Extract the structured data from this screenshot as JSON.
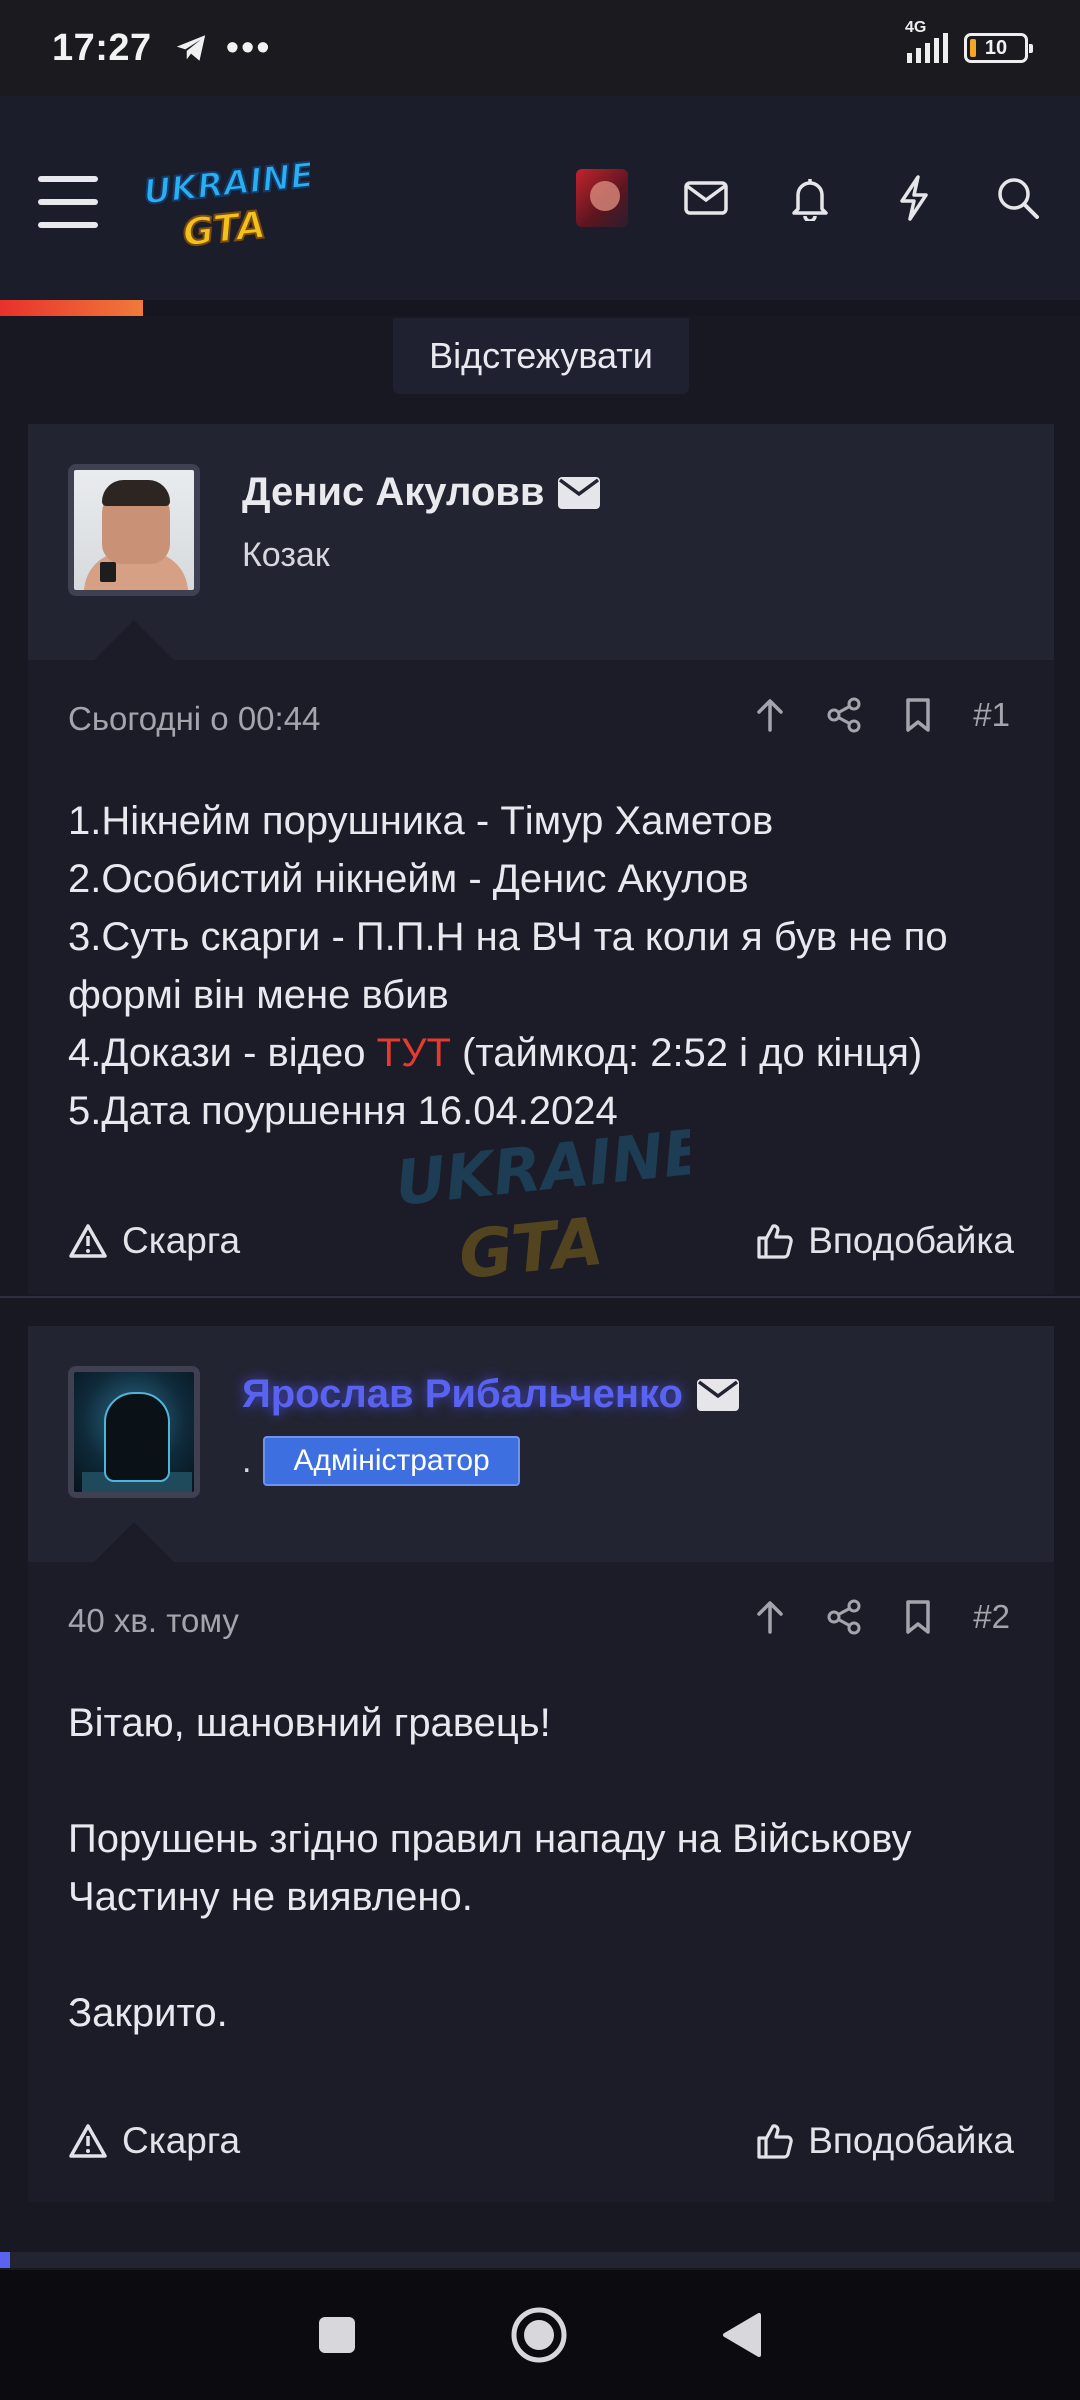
{
  "status_bar": {
    "time": "17:27",
    "dots": "•••",
    "network": "4G",
    "battery": "10"
  },
  "header": {
    "logo_top": "UKRAINE",
    "logo_bottom": "GTA",
    "icons": [
      "user-avatar",
      "mail-icon",
      "bell-icon",
      "bolt-icon",
      "search-icon"
    ],
    "reading_progress": 0.2
  },
  "follow_button": "Відстежувати",
  "posts": [
    {
      "author": "Денис Акуловв",
      "user_title": "Козак",
      "time": "Сьогодні о 00:44",
      "number": "#1",
      "content": {
        "line1": "1.Нікнейм порушника - Тімур Хаметов",
        "line2": "2.Особистий нікнейм - Денис Акулов",
        "line3": "3.Суть скарги - П.П.Н на ВЧ та коли я був не по формі він мене вбив",
        "line4_before": "4.Докази - відео ",
        "line4_link": "ТУТ",
        "line4_after": " (таймкод: 2:52 і до кінця)",
        "line5": "5.Дата поуршення 16.04.2024"
      },
      "report_label": "Скарга",
      "like_label": "Вподобайка"
    },
    {
      "author": "Ярослав Рибальченко",
      "role_prefix": ".",
      "role": "Адміністратор",
      "time": "40 хв. тому",
      "number": "#2",
      "content": {
        "p1": "Вітаю, шановний гравець!",
        "p2": "Порушень згідно правил нападу на Військову Частину не виявлено.",
        "p3": "Закрито."
      },
      "report_label": "Скарга",
      "like_label": "Вподобайка"
    }
  ],
  "colors": {
    "accent_red": "#e53a2e",
    "admin_name": "#5a63f0",
    "role_badge": "#3e6fe0",
    "background": "#181822"
  }
}
